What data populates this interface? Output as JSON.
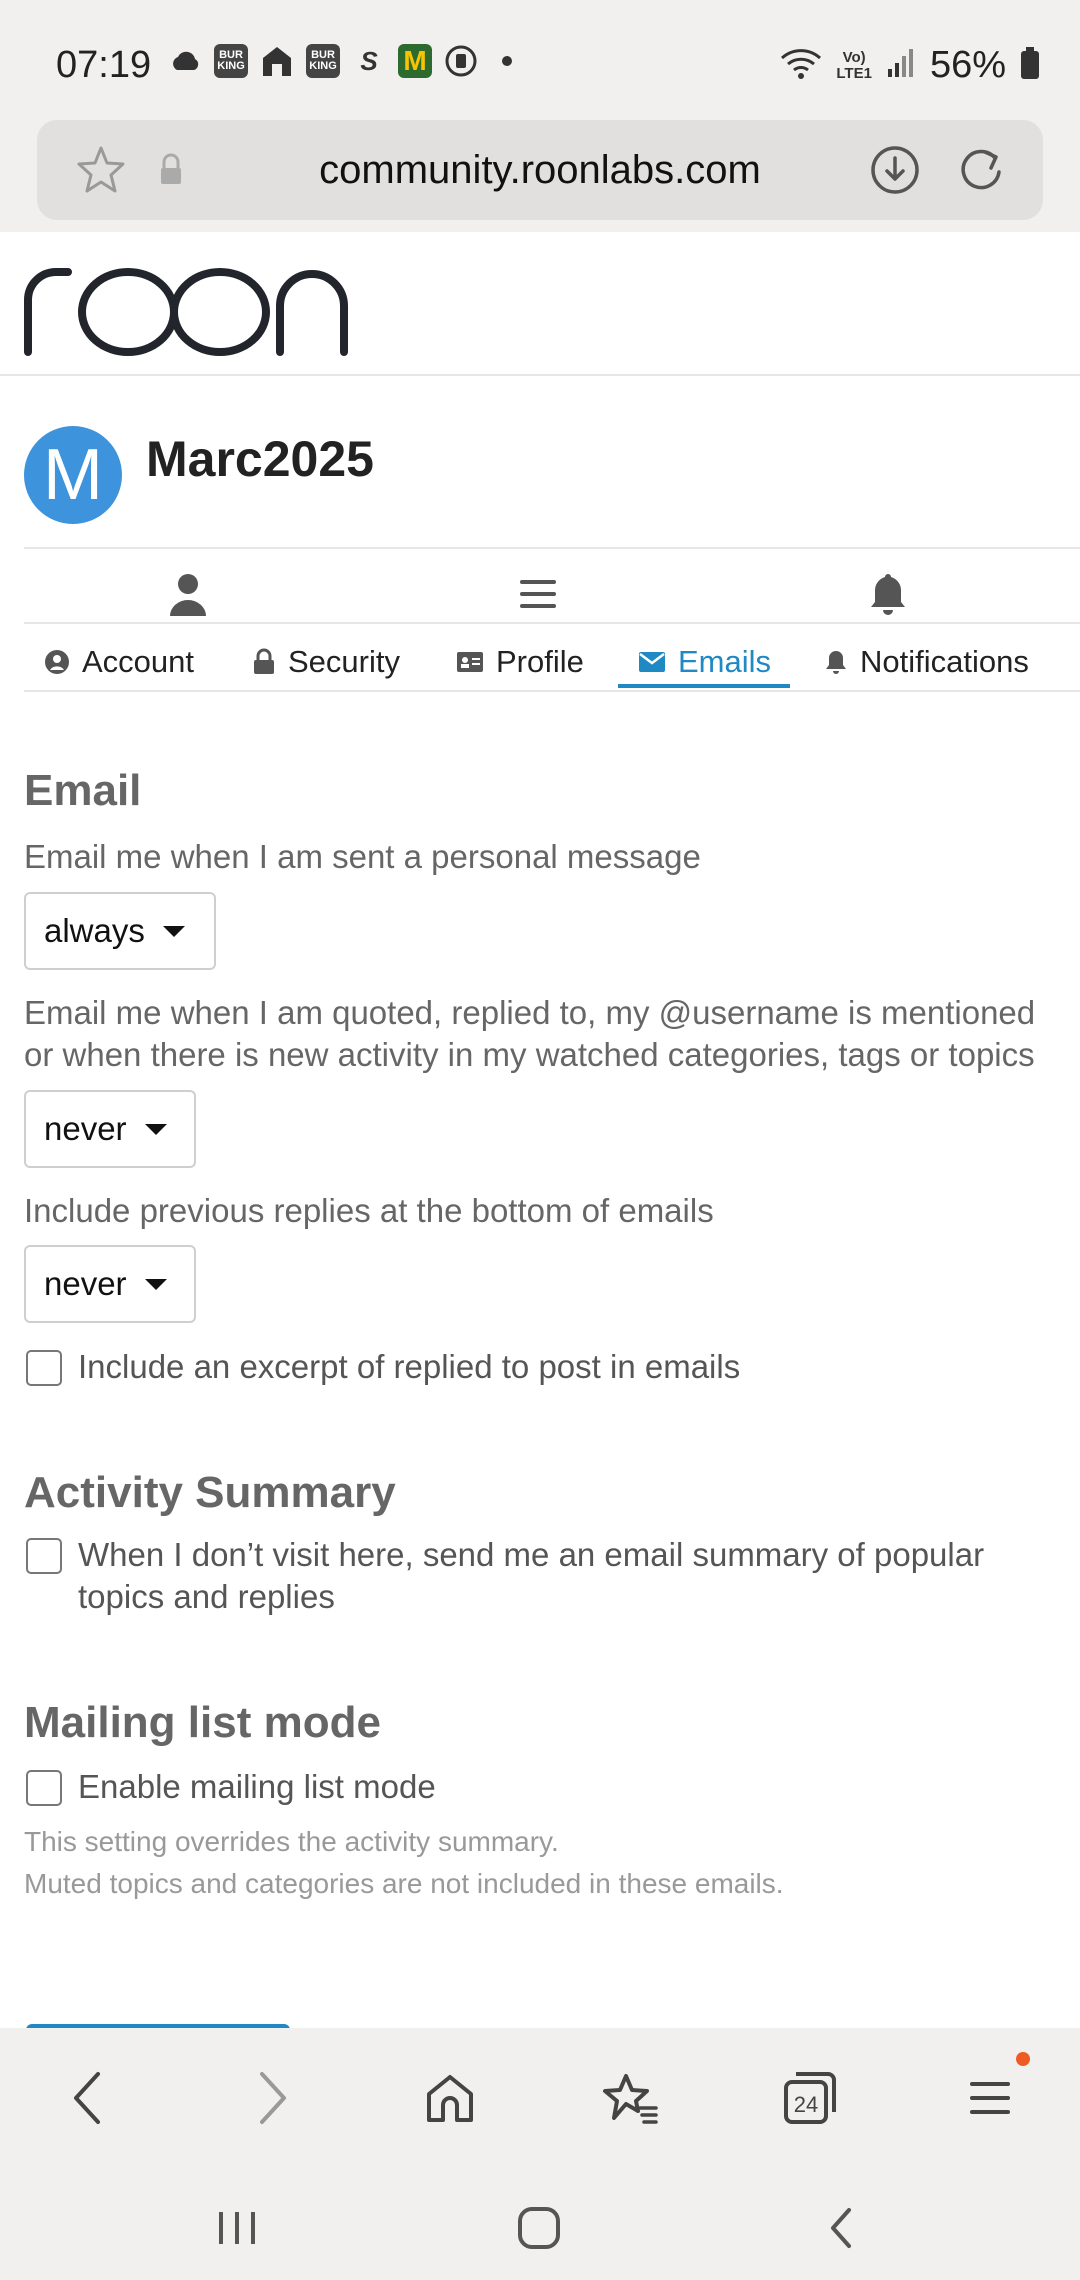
{
  "status_bar": {
    "time": "07:19",
    "battery": "56%",
    "icons": [
      "cloud-icon",
      "burger-king-icon",
      "home-app-icon",
      "burger-king-icon",
      "s-app-icon",
      "mcdonalds-icon",
      "sync-icon",
      "dot-icon",
      "wifi-icon",
      "volte-icon",
      "signal-icon",
      "battery-icon"
    ]
  },
  "browser": {
    "url": "community.roonlabs.com",
    "tab_count": "24"
  },
  "site": {
    "logo_text": "roon"
  },
  "user": {
    "avatar_letter": "M",
    "username": "Marc2025",
    "avatar_color": "#3d93dc"
  },
  "tabs": [
    {
      "label": "Account",
      "icon": "user-circle-icon"
    },
    {
      "label": "Security",
      "icon": "lock-icon"
    },
    {
      "label": "Profile",
      "icon": "id-card-icon"
    },
    {
      "label": "Emails",
      "icon": "envelope-icon",
      "active": true
    },
    {
      "label": "Notifications",
      "icon": "bell-icon"
    }
  ],
  "email": {
    "heading": "Email",
    "pm_label": "Email me when I am sent a personal message",
    "pm_value": "always",
    "mention_label_line1": "Email me when I am quoted, replied to, my @username is mentioned",
    "mention_label_line2": "or when there is new activity in my watched categories, tags or topics",
    "mention_value": "never",
    "prev_replies_label": "Include previous replies at the bottom of emails",
    "prev_replies_value": "never",
    "excerpt_label": "Include an excerpt of replied to post in emails",
    "excerpt_checked": false
  },
  "activity_summary": {
    "heading": "Activity Summary",
    "label_line1": "When I don’t visit here, send me an email summary of popular",
    "label_line2": "topics and replies",
    "checked": false
  },
  "mailing_list": {
    "heading": "Mailing list mode",
    "label": "Enable mailing list mode",
    "checked": false,
    "help_line1": "This setting overrides the activity summary.",
    "help_line2": "Muted topics and categories are not included in these emails."
  },
  "colors": {
    "accent": "#1e89c3",
    "notification_dot": "#ee5a24"
  }
}
